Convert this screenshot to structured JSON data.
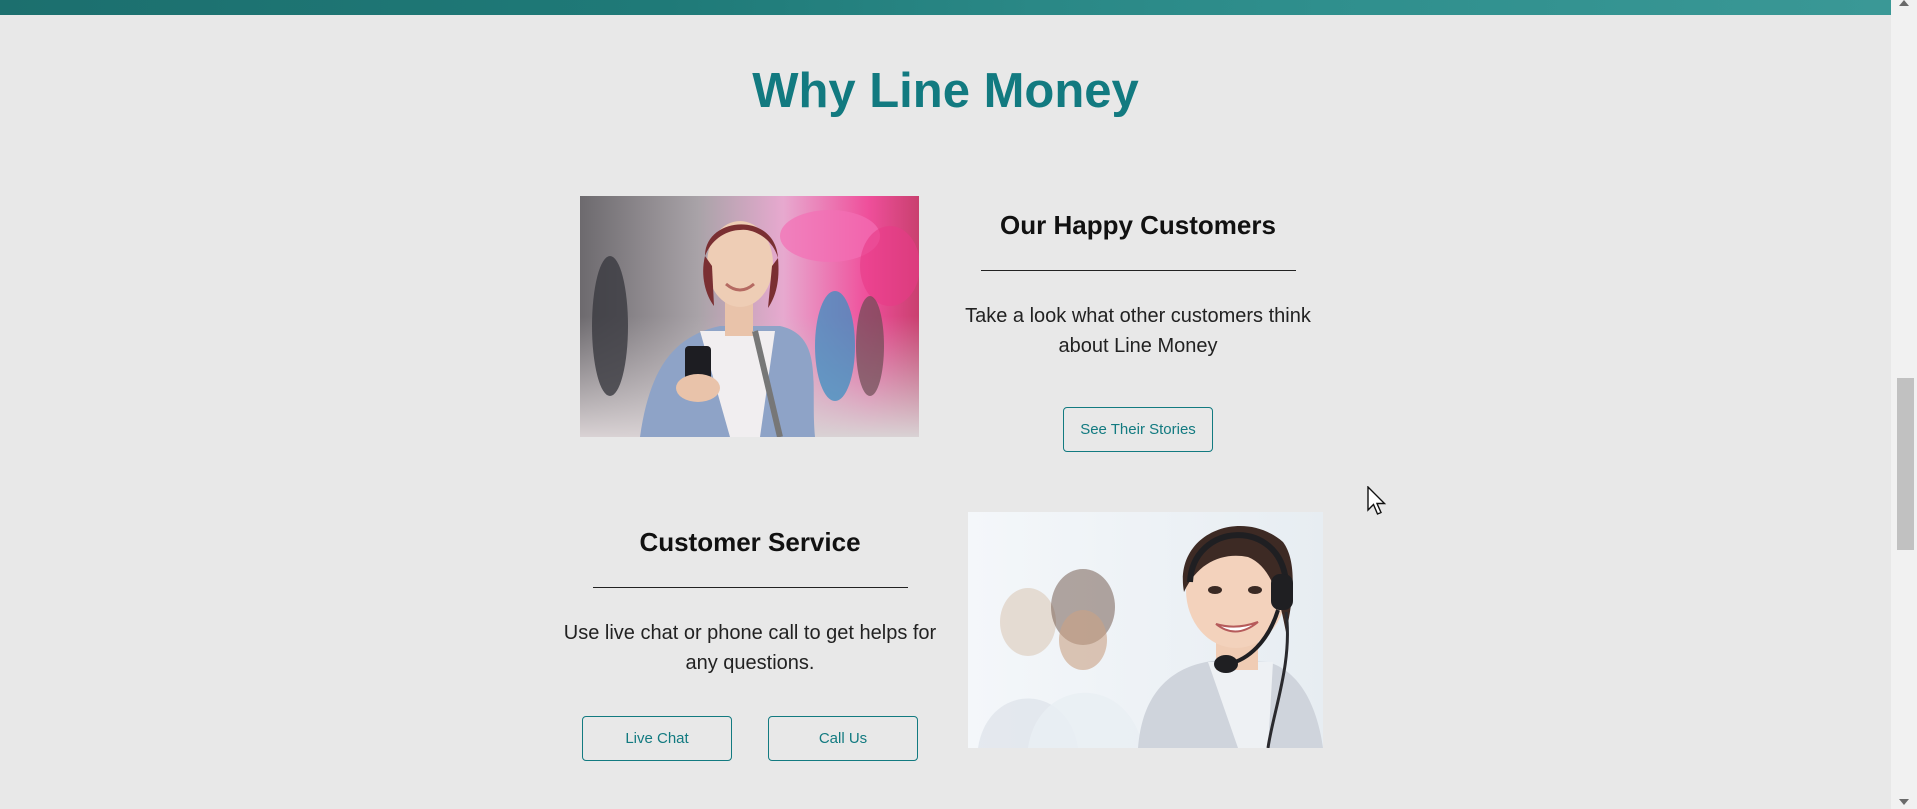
{
  "section": {
    "title": "Why Line Money"
  },
  "happy_customers": {
    "title": "Our Happy Customers",
    "description": "Take a look what other customers think about Line Money",
    "button_label": "See Their Stories",
    "image_subject": "woman-using-smartphone-photo"
  },
  "customer_service": {
    "title": "Customer Service",
    "description": "Use live chat or phone call to get helps for any questions.",
    "live_chat_label": "Live Chat",
    "call_us_label": "Call Us",
    "image_subject": "support-agent-with-headset-photo"
  },
  "colors": {
    "accent": "#127a80",
    "banner": "#1f7a78",
    "background": "#e8e8e8",
    "text": "#222222"
  }
}
